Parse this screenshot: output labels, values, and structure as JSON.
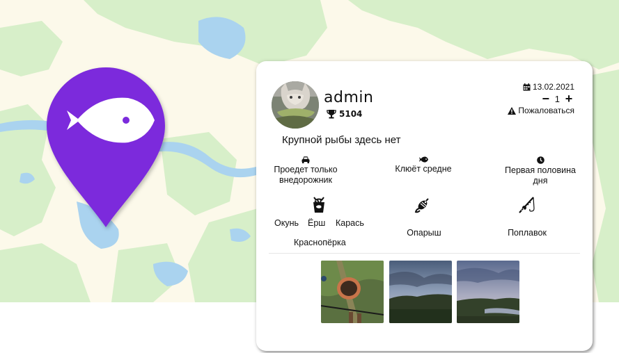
{
  "map": {
    "land_color": "#fcf9ea",
    "forest_color": "#d7efc9",
    "water_color": "#aad3ef"
  },
  "marker": {
    "icon": "fish-icon",
    "color": "#7b2bdc"
  },
  "report": {
    "username": "admin",
    "rating": "5104",
    "rating_icon": "trophy-icon",
    "date": "13.02.2021",
    "date_icon": "calendar-icon",
    "vote_count": "1",
    "vote_minus": "−",
    "vote_plus": "+",
    "complaint_label": "Пожаловаться",
    "complaint_icon": "warning-icon",
    "comment": "Крупной рыбы здесь нет",
    "access": "Проедет только внедорожник",
    "access_icon": "car-icon",
    "bite": "Клюёт средне",
    "bite_icon": "fish-icon",
    "time_of_day": "Первая половина дня",
    "time_icon": "clock-icon",
    "fish_icon": "bucket-icon",
    "fish": [
      "Окунь",
      "Ёрш",
      "Карась",
      "Краснопёрка"
    ],
    "bait_icon": "lure-icon",
    "bait": "Опарыш",
    "tackle_icon": "fishing-rod-icon",
    "tackle": "Поплавок",
    "photos": [
      "photo-bucket-grass",
      "photo-sky-forest",
      "photo-river-evening"
    ]
  }
}
